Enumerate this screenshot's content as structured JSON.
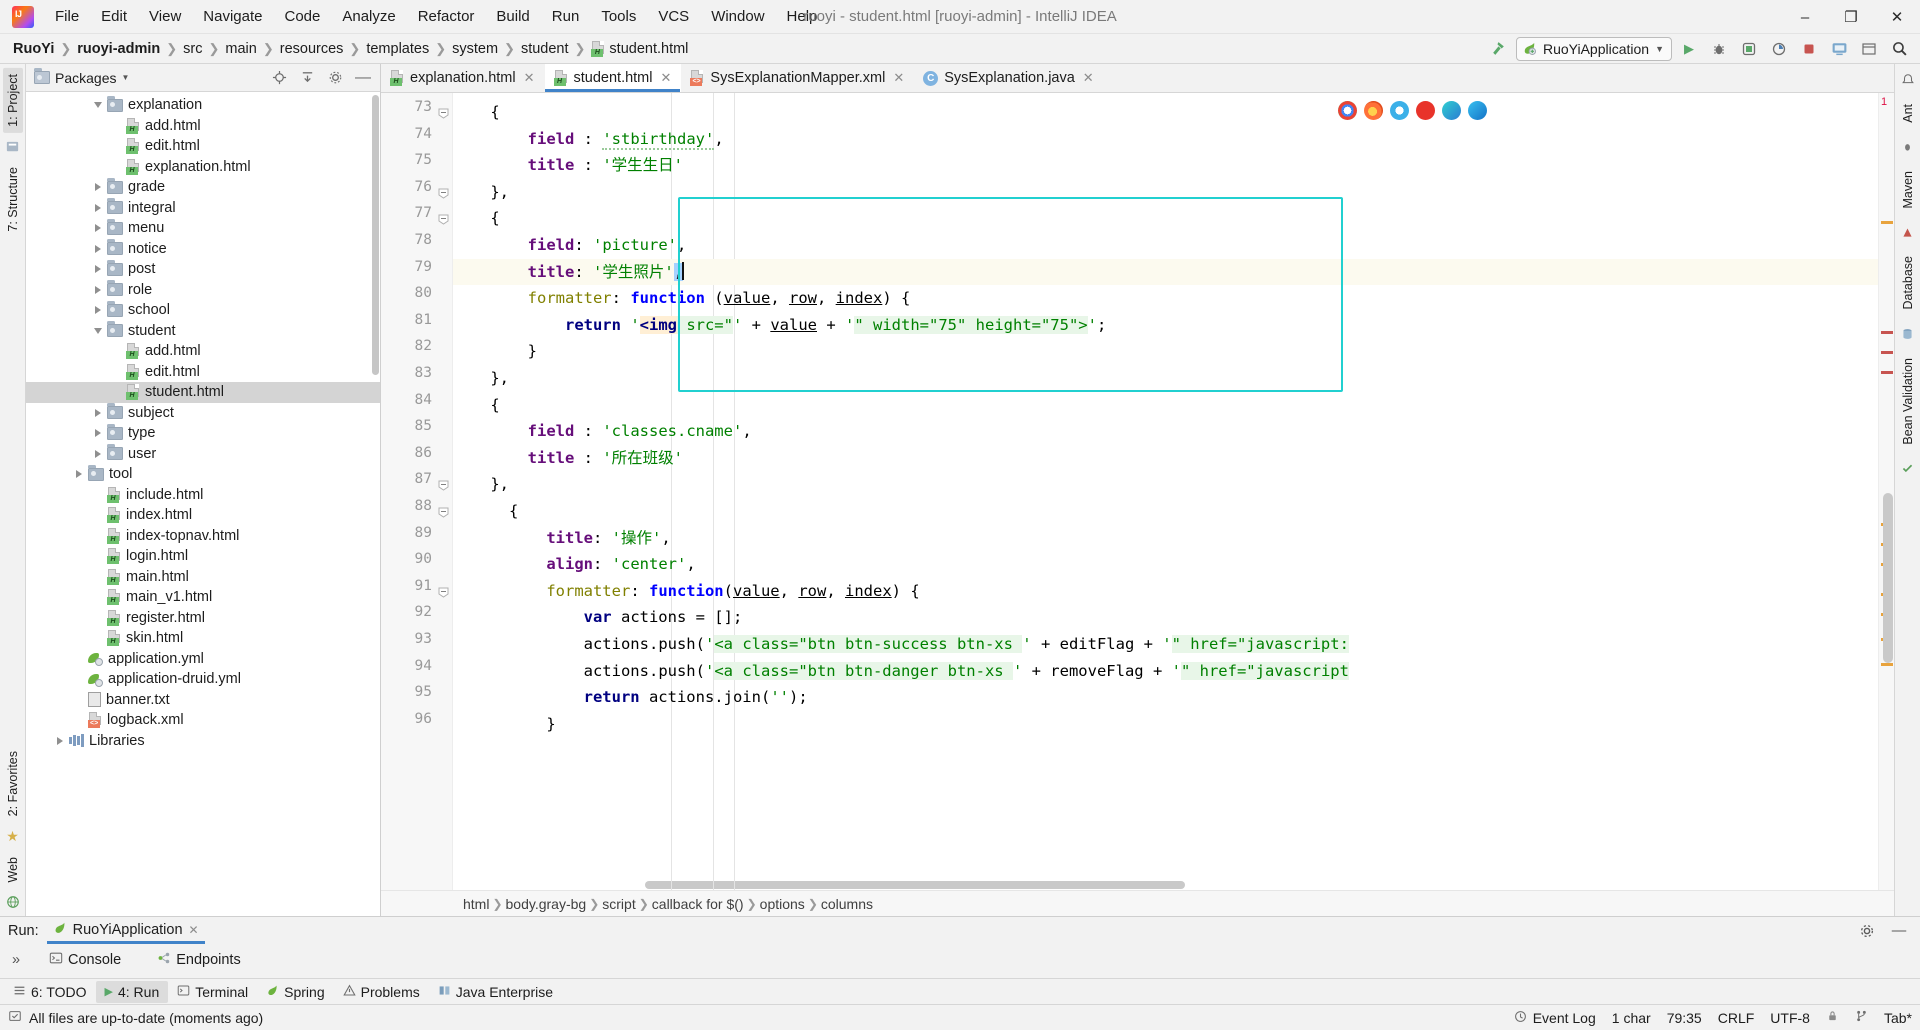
{
  "window": {
    "title": "ruoyi - student.html [ruoyi-admin] - IntelliJ IDEA",
    "logo_name": "intellij-idea-logo",
    "minimize": "–",
    "maximize": "❐",
    "close": "✕"
  },
  "menu": [
    {
      "label": "File"
    },
    {
      "label": "Edit"
    },
    {
      "label": "View"
    },
    {
      "label": "Navigate"
    },
    {
      "label": "Code"
    },
    {
      "label": "Analyze"
    },
    {
      "label": "Refactor"
    },
    {
      "label": "Build"
    },
    {
      "label": "Run"
    },
    {
      "label": "Tools"
    },
    {
      "label": "VCS"
    },
    {
      "label": "Window"
    },
    {
      "label": "Help"
    }
  ],
  "breadcrumb": [
    {
      "label": "RuoYi",
      "bold": true
    },
    {
      "label": "ruoyi-admin",
      "bold": true
    },
    {
      "label": "src",
      "bold": false
    },
    {
      "label": "main",
      "bold": false
    },
    {
      "label": "resources",
      "bold": false
    },
    {
      "label": "templates",
      "bold": false
    },
    {
      "label": "system",
      "bold": false
    },
    {
      "label": "student",
      "bold": false
    },
    {
      "label": "student.html",
      "bold": false,
      "icon": "html-file-icon"
    }
  ],
  "toolbar": {
    "build_icon": "hammer-icon",
    "run_config": "RuoYiApplication",
    "run_config_icon": "spring-boot-icon",
    "dropdown_icon": "chevron-down-icon",
    "actions": [
      {
        "name": "run-button",
        "glyph": "▶",
        "color": "#59a869"
      },
      {
        "name": "debug-button",
        "glyph": "☢",
        "color": "#6e6e6e"
      },
      {
        "name": "run-with-coverage-button",
        "glyph": "▣",
        "color": "#6e6e6e"
      },
      {
        "name": "profiler-button",
        "glyph": "⚙",
        "color": "#6e6e6e"
      },
      {
        "name": "stop-button",
        "glyph": "■",
        "color": "#c75450"
      },
      {
        "name": "update-app-button",
        "glyph": "↻",
        "color": "#4b7fb5"
      },
      {
        "name": "layout-button",
        "glyph": "▥",
        "color": "#6e6e6e"
      },
      {
        "name": "search-everywhere-button",
        "glyph": "⚲",
        "color": "#3c3c3c"
      }
    ]
  },
  "left_rail": {
    "top": [
      {
        "label": "1: Project",
        "selected": true,
        "name": "tool-tab-project"
      },
      {
        "label": "7: Structure",
        "selected": false,
        "name": "tool-tab-structure"
      }
    ],
    "bottom": [
      {
        "label": "2: Favorites",
        "name": "tool-tab-favorites"
      },
      {
        "label": "Web",
        "name": "tool-tab-web"
      }
    ]
  },
  "right_rail": [
    {
      "label": "Ant",
      "name": "tool-tab-ant"
    },
    {
      "label": "Maven",
      "name": "tool-tab-maven"
    },
    {
      "label": "Database",
      "name": "tool-tab-database"
    },
    {
      "label": "Bean Validation",
      "name": "tool-tab-bean-validation"
    }
  ],
  "project_panel": {
    "title": "Packages",
    "title_dropdown_icon": "chevron-down-icon",
    "actions": [
      {
        "name": "locate-icon",
        "glyph": "⌖"
      },
      {
        "name": "collapse-all-icon",
        "glyph": "↥"
      },
      {
        "name": "settings-icon",
        "glyph": "⚙"
      },
      {
        "name": "hide-icon",
        "glyph": "—"
      }
    ],
    "tree": [
      {
        "label": "explanation",
        "indent": 3,
        "type": "folder",
        "state": "open"
      },
      {
        "label": "add.html",
        "indent": 4,
        "type": "html"
      },
      {
        "label": "edit.html",
        "indent": 4,
        "type": "html"
      },
      {
        "label": "explanation.html",
        "indent": 4,
        "type": "html"
      },
      {
        "label": "grade",
        "indent": 3,
        "type": "folder",
        "state": "closed"
      },
      {
        "label": "integral",
        "indent": 3,
        "type": "folder",
        "state": "closed"
      },
      {
        "label": "menu",
        "indent": 3,
        "type": "folder",
        "state": "closed"
      },
      {
        "label": "notice",
        "indent": 3,
        "type": "folder",
        "state": "closed"
      },
      {
        "label": "post",
        "indent": 3,
        "type": "folder",
        "state": "closed"
      },
      {
        "label": "role",
        "indent": 3,
        "type": "folder",
        "state": "closed"
      },
      {
        "label": "school",
        "indent": 3,
        "type": "folder",
        "state": "closed"
      },
      {
        "label": "student",
        "indent": 3,
        "type": "folder",
        "state": "open"
      },
      {
        "label": "add.html",
        "indent": 4,
        "type": "html"
      },
      {
        "label": "edit.html",
        "indent": 4,
        "type": "html"
      },
      {
        "label": "student.html",
        "indent": 4,
        "type": "html",
        "selected": true
      },
      {
        "label": "subject",
        "indent": 3,
        "type": "folder",
        "state": "closed"
      },
      {
        "label": "type",
        "indent": 3,
        "type": "folder",
        "state": "closed"
      },
      {
        "label": "user",
        "indent": 3,
        "type": "folder",
        "state": "closed"
      },
      {
        "label": "tool",
        "indent": 2,
        "type": "folder",
        "state": "closed"
      },
      {
        "label": "include.html",
        "indent": 3,
        "type": "html"
      },
      {
        "label": "index.html",
        "indent": 3,
        "type": "html"
      },
      {
        "label": "index-topnav.html",
        "indent": 3,
        "type": "html"
      },
      {
        "label": "login.html",
        "indent": 3,
        "type": "html"
      },
      {
        "label": "main.html",
        "indent": 3,
        "type": "html"
      },
      {
        "label": "main_v1.html",
        "indent": 3,
        "type": "html"
      },
      {
        "label": "register.html",
        "indent": 3,
        "type": "html"
      },
      {
        "label": "skin.html",
        "indent": 3,
        "type": "html"
      },
      {
        "label": "application.yml",
        "indent": 2,
        "type": "yml"
      },
      {
        "label": "application-druid.yml",
        "indent": 2,
        "type": "yml"
      },
      {
        "label": "banner.txt",
        "indent": 2,
        "type": "txt"
      },
      {
        "label": "logback.xml",
        "indent": 2,
        "type": "xml"
      },
      {
        "label": "Libraries",
        "indent": 1,
        "type": "libraries",
        "state": "closed"
      }
    ]
  },
  "editor_tabs": [
    {
      "label": "explanation.html",
      "type": "html",
      "active": false,
      "name": "editor-tab-explanation-html"
    },
    {
      "label": "student.html",
      "type": "html",
      "active": true,
      "name": "editor-tab-student-html"
    },
    {
      "label": "SysExplanationMapper.xml",
      "type": "xml",
      "active": false,
      "name": "editor-tab-sysexplanationmapper-xml"
    },
    {
      "label": "SysExplanation.java",
      "type": "java",
      "active": false,
      "name": "editor-tab-sysexplanation-java"
    }
  ],
  "code": {
    "first_line": 73,
    "highlighted_line": 79,
    "selection_block": {
      "from": 77,
      "to": 83
    },
    "lines": [
      {
        "n": 73,
        "fold": "minus",
        "tokens": [
          {
            "t": "punc",
            "v": "    {"
          }
        ]
      },
      {
        "n": 74,
        "tokens": [
          {
            "t": "key",
            "v": "        field "
          },
          {
            "t": "punc",
            "v": ": "
          },
          {
            "t": "str-squig",
            "v": "'stbirthday'"
          },
          {
            "t": "punc",
            "v": ","
          }
        ]
      },
      {
        "n": 75,
        "tokens": [
          {
            "t": "key",
            "v": "        title "
          },
          {
            "t": "punc",
            "v": ": "
          },
          {
            "t": "str",
            "v": "'学生生日'"
          }
        ]
      },
      {
        "n": 76,
        "fold": "minus",
        "tokens": [
          {
            "t": "punc",
            "v": "    },"
          }
        ]
      },
      {
        "n": 77,
        "fold": "minus",
        "tokens": [
          {
            "t": "punc",
            "v": "    {"
          }
        ]
      },
      {
        "n": 78,
        "tokens": [
          {
            "t": "key",
            "v": "        field"
          },
          {
            "t": "punc",
            "v": ": "
          },
          {
            "t": "str",
            "v": "'picture'"
          },
          {
            "t": "punc",
            "v": ","
          }
        ]
      },
      {
        "n": 79,
        "tokens": [
          {
            "t": "key",
            "v": "        title"
          },
          {
            "t": "punc",
            "v": ": "
          },
          {
            "t": "str",
            "v": "'学生照片'"
          },
          {
            "t": "sel",
            "v": ","
          },
          {
            "t": "caret",
            "v": ""
          }
        ]
      },
      {
        "n": 80,
        "tokens": [
          {
            "t": "prop",
            "v": "        formatter"
          },
          {
            "t": "punc",
            "v": ": "
          },
          {
            "t": "fn",
            "v": "function"
          },
          {
            "t": "punc",
            "v": " ("
          },
          {
            "t": "par",
            "v": "value"
          },
          {
            "t": "punc",
            "v": ", "
          },
          {
            "t": "par",
            "v": "row"
          },
          {
            "t": "punc",
            "v": ", "
          },
          {
            "t": "par",
            "v": "index"
          },
          {
            "t": "punc",
            "v": ") {"
          }
        ]
      },
      {
        "n": 81,
        "tokens": [
          {
            "t": "kw",
            "v": "            return "
          },
          {
            "t": "str",
            "v": "'"
          },
          {
            "t": "tag",
            "v": "<img"
          },
          {
            "t": "inj",
            "v": " src=\""
          },
          {
            "t": "str",
            "v": "'"
          },
          {
            "t": "punc",
            "v": " + "
          },
          {
            "t": "par",
            "v": "value"
          },
          {
            "t": "punc",
            "v": " + "
          },
          {
            "t": "str",
            "v": "'"
          },
          {
            "t": "inj",
            "v": "\" width=\"75\" height=\"75\">"
          },
          {
            "t": "str",
            "v": "'"
          },
          {
            "t": "punc",
            "v": ";"
          }
        ]
      },
      {
        "n": 82,
        "tokens": [
          {
            "t": "punc",
            "v": "        }"
          }
        ]
      },
      {
        "n": 83,
        "tokens": [
          {
            "t": "punc",
            "v": "    },"
          }
        ]
      },
      {
        "n": 84,
        "tokens": [
          {
            "t": "punc",
            "v": "    {"
          }
        ]
      },
      {
        "n": 85,
        "tokens": [
          {
            "t": "key",
            "v": "        field "
          },
          {
            "t": "punc",
            "v": ": "
          },
          {
            "t": "str",
            "v": "'classes.cname'"
          },
          {
            "t": "punc",
            "v": ","
          }
        ]
      },
      {
        "n": 86,
        "tokens": [
          {
            "t": "key",
            "v": "        title "
          },
          {
            "t": "punc",
            "v": ": "
          },
          {
            "t": "str",
            "v": "'所在班级'"
          }
        ]
      },
      {
        "n": 87,
        "fold": "minus",
        "tokens": [
          {
            "t": "punc",
            "v": "    },"
          }
        ]
      },
      {
        "n": 88,
        "fold": "minus",
        "tokens": [
          {
            "t": "punc",
            "v": "      {"
          }
        ]
      },
      {
        "n": 89,
        "tokens": [
          {
            "t": "key",
            "v": "          title"
          },
          {
            "t": "punc",
            "v": ": "
          },
          {
            "t": "str",
            "v": "'操作'"
          },
          {
            "t": "punc",
            "v": ","
          }
        ]
      },
      {
        "n": 90,
        "tokens": [
          {
            "t": "key",
            "v": "          align"
          },
          {
            "t": "punc",
            "v": ": "
          },
          {
            "t": "str",
            "v": "'center'"
          },
          {
            "t": "punc",
            "v": ","
          }
        ]
      },
      {
        "n": 91,
        "fold": "minus",
        "tokens": [
          {
            "t": "prop",
            "v": "          formatter"
          },
          {
            "t": "punc",
            "v": ": "
          },
          {
            "t": "fn",
            "v": "function"
          },
          {
            "t": "punc",
            "v": "("
          },
          {
            "t": "par",
            "v": "value"
          },
          {
            "t": "punc",
            "v": ", "
          },
          {
            "t": "par",
            "v": "row"
          },
          {
            "t": "punc",
            "v": ", "
          },
          {
            "t": "par",
            "v": "index"
          },
          {
            "t": "punc",
            "v": ") {"
          }
        ]
      },
      {
        "n": 92,
        "tokens": [
          {
            "t": "kw",
            "v": "              var "
          },
          {
            "t": "id",
            "v": "actions"
          },
          {
            "t": "punc",
            "v": " = [];"
          }
        ]
      },
      {
        "n": 93,
        "tokens": [
          {
            "t": "id",
            "v": "              actions"
          },
          {
            "t": "punc",
            "v": "."
          },
          {
            "t": "id",
            "v": "push"
          },
          {
            "t": "punc",
            "v": "("
          },
          {
            "t": "str",
            "v": "'"
          },
          {
            "t": "inj",
            "v": "<a class=\"btn btn-success btn-xs "
          },
          {
            "t": "str",
            "v": "'"
          },
          {
            "t": "punc",
            "v": " + "
          },
          {
            "t": "id",
            "v": "editFlag"
          },
          {
            "t": "punc",
            "v": " + "
          },
          {
            "t": "str",
            "v": "'"
          },
          {
            "t": "inj",
            "v": "\" href=\"javascript:"
          }
        ]
      },
      {
        "n": 94,
        "tokens": [
          {
            "t": "id",
            "v": "              actions"
          },
          {
            "t": "punc",
            "v": "."
          },
          {
            "t": "id",
            "v": "push"
          },
          {
            "t": "punc",
            "v": "("
          },
          {
            "t": "str",
            "v": "'"
          },
          {
            "t": "inj",
            "v": "<a class=\"btn btn-danger btn-xs "
          },
          {
            "t": "str",
            "v": "'"
          },
          {
            "t": "punc",
            "v": " + "
          },
          {
            "t": "id",
            "v": "removeFlag"
          },
          {
            "t": "punc",
            "v": " + "
          },
          {
            "t": "str",
            "v": "'"
          },
          {
            "t": "inj",
            "v": "\" href=\"javascript"
          }
        ]
      },
      {
        "n": 95,
        "tokens": [
          {
            "t": "kw",
            "v": "              return "
          },
          {
            "t": "id",
            "v": "actions"
          },
          {
            "t": "punc",
            "v": "."
          },
          {
            "t": "id",
            "v": "join"
          },
          {
            "t": "punc",
            "v": "("
          },
          {
            "t": "str",
            "v": "''"
          },
          {
            "t": "punc",
            "v": ");"
          }
        ]
      },
      {
        "n": 96,
        "tokens": [
          {
            "t": "punc",
            "v": "          }"
          }
        ]
      }
    ]
  },
  "editor_breadcrumb": [
    {
      "label": "html"
    },
    {
      "label": "body.gray-bg"
    },
    {
      "label": "script"
    },
    {
      "label": "callback for $()"
    },
    {
      "label": "options"
    },
    {
      "label": "columns"
    }
  ],
  "browser_popup": {
    "icons": [
      "chrome-icon",
      "firefox-icon",
      "safari-icon",
      "opera-icon",
      "edge-icon",
      "ie-icon"
    ]
  },
  "run_window": {
    "label": "Run:",
    "config_name": "RuoYiApplication",
    "close_icon": "close-icon",
    "settings_icon": "gear-icon",
    "hide_icon": "minimize-icon",
    "tabs": [
      {
        "label": "Console",
        "icon": "console-icon",
        "name": "run-tab-console"
      },
      {
        "label": "Endpoints",
        "icon": "endpoints-icon",
        "name": "run-tab-endpoints"
      }
    ],
    "expand_glyph": "»"
  },
  "tool_strip": [
    {
      "label": "6: TODO",
      "icon": "todo-icon",
      "active": false,
      "name": "toolstrip-todo"
    },
    {
      "label": "4: Run",
      "icon": "run-icon",
      "active": true,
      "name": "toolstrip-run"
    },
    {
      "label": "Terminal",
      "icon": "terminal-icon",
      "active": false,
      "name": "toolstrip-terminal"
    },
    {
      "label": "Spring",
      "icon": "spring-icon",
      "active": false,
      "name": "toolstrip-spring"
    },
    {
      "label": "Problems",
      "icon": "problems-icon",
      "active": false,
      "name": "toolstrip-problems"
    },
    {
      "label": "Java Enterprise",
      "icon": "java-enterprise-icon",
      "active": false,
      "name": "toolstrip-java-enterprise"
    }
  ],
  "status_bar": {
    "message": "All files are up-to-date (moments ago)",
    "message_icon": "sync-icon",
    "event_log": "Event Log",
    "event_log_icon": "event-log-icon",
    "char_count": "1 char",
    "caret_position": "79:35",
    "line_separator": "CRLF",
    "encoding": "UTF-8",
    "lock_icon": "lock-icon",
    "branch_icon": "branch-icon",
    "indent": "Tab*"
  },
  "colors": {
    "accent": "#4083c9",
    "selection_box": "#21d0d0",
    "highlight_line": "#fcfaef",
    "string": "#008000",
    "keyword": "#660e7a",
    "function": "#0000ff",
    "error": "#d14"
  }
}
